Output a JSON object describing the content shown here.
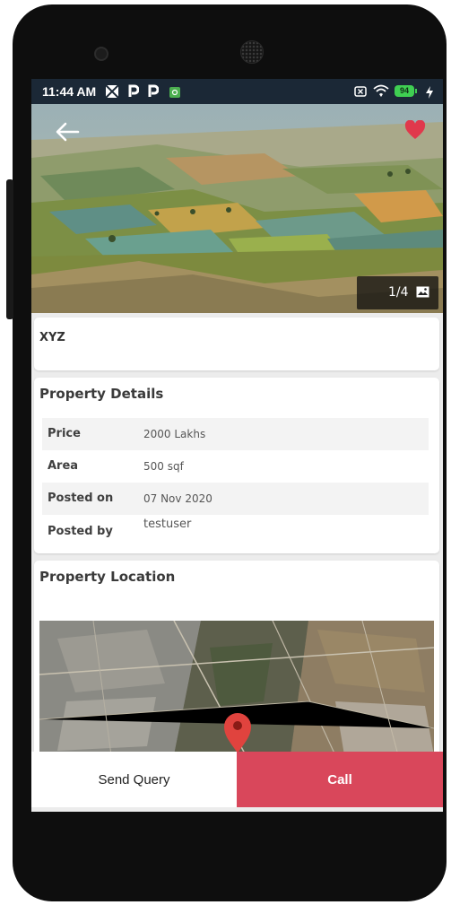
{
  "status_bar": {
    "time": "11:44 AM",
    "icons": [
      "photos-icon",
      "parking-app-icon",
      "parking-app-icon",
      "app-notification-icon"
    ],
    "right_icons": [
      "sim-blocked-icon",
      "wifi-icon"
    ],
    "battery": "94"
  },
  "hero": {
    "image_counter": "1/4",
    "favorite_color": "#e0394c"
  },
  "listing": {
    "title": "XYZ"
  },
  "details": {
    "heading": "Property Details",
    "rows": [
      {
        "label": "Price",
        "value": "2000 Lakhs"
      },
      {
        "label": "Area",
        "value": "500 sqf"
      },
      {
        "label": "Posted on",
        "value": "07 Nov 2020"
      },
      {
        "label": "Posted by",
        "value": "testuser"
      }
    ]
  },
  "location": {
    "heading": "Property Location"
  },
  "actions": {
    "send_query_label": "Send Query",
    "call_label": "Call",
    "call_color": "#d9475b"
  }
}
